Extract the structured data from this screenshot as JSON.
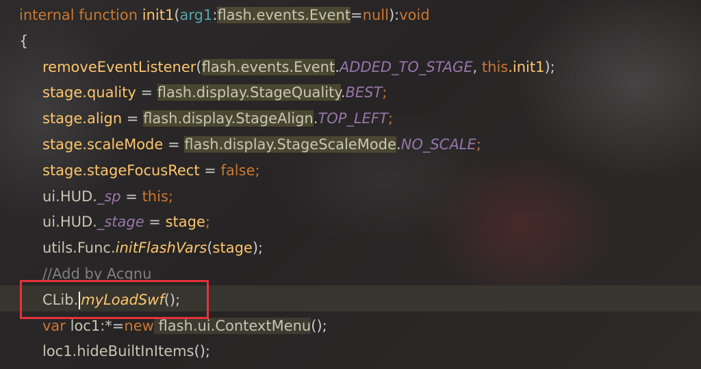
{
  "code": {
    "signature": {
      "modifier": "internal",
      "keyword": "function",
      "name": "init1",
      "open_paren": "(",
      "param_name": "arg1",
      "colon": ":",
      "param_type": "flash.events.Event",
      "equals": "=",
      "default_value": "null",
      "close_paren": ")",
      "colon2": ":",
      "return_type": "void"
    },
    "open_brace": "{",
    "line1": {
      "call": "removeEventListener",
      "open": "(",
      "cls": "flash.events.Event",
      "dot": ".",
      "constant": "ADDED_TO_STAGE",
      "comma": ", ",
      "this_kw": "this",
      "member": ".init1",
      "close": ");"
    },
    "line2": {
      "lhs": "stage.quality",
      "eq": " = ",
      "cls": "flash.display.StageQuality",
      "dot": ".",
      "constant": "BEST",
      "end": ";"
    },
    "line3": {
      "lhs": "stage.align",
      "eq": " = ",
      "cls": "flash.display.StageAlign",
      "dot": ".",
      "constant": "TOP_LEFT",
      "end": ";"
    },
    "line4": {
      "lhs": "stage.scaleMode",
      "eq": " = ",
      "cls": "flash.display.StageScaleMode",
      "dot": ".",
      "constant": "NO_SCALE",
      "end": ";"
    },
    "line5": {
      "lhs": "stage.stageFocusRect",
      "eq": " = ",
      "value": "false",
      "end": ";"
    },
    "line6": {
      "obj": "ui.HUD.",
      "member": "_sp",
      "eq": " = ",
      "value": "this",
      "end": ";"
    },
    "line7": {
      "obj": "ui.HUD.",
      "member": "_stage",
      "eq": " = ",
      "value": "stage",
      "end": ";"
    },
    "line8": {
      "obj": "utils.Func.",
      "method": "initFlashVars",
      "open": "(",
      "arg": "stage",
      "close": ");"
    },
    "line9": {
      "comment": "//Add by Acgnu"
    },
    "line10": {
      "obj": "CLib.",
      "method": "myLoadSwf",
      "call": "();"
    },
    "line11": {
      "kw": "var",
      "name": " loc1:*",
      "eq": "=",
      "new_kw": "new",
      "cls": " flash.ui.ContextMenu",
      "call": "();"
    },
    "line12": {
      "text": "loc1.hideBuiltInItems",
      "call": "();"
    }
  },
  "colors": {
    "keyword": "#cc7832",
    "function_name": "#ffc66d",
    "constant": "#9876aa",
    "comment": "#808080",
    "annotation_box": "#e8323c"
  }
}
